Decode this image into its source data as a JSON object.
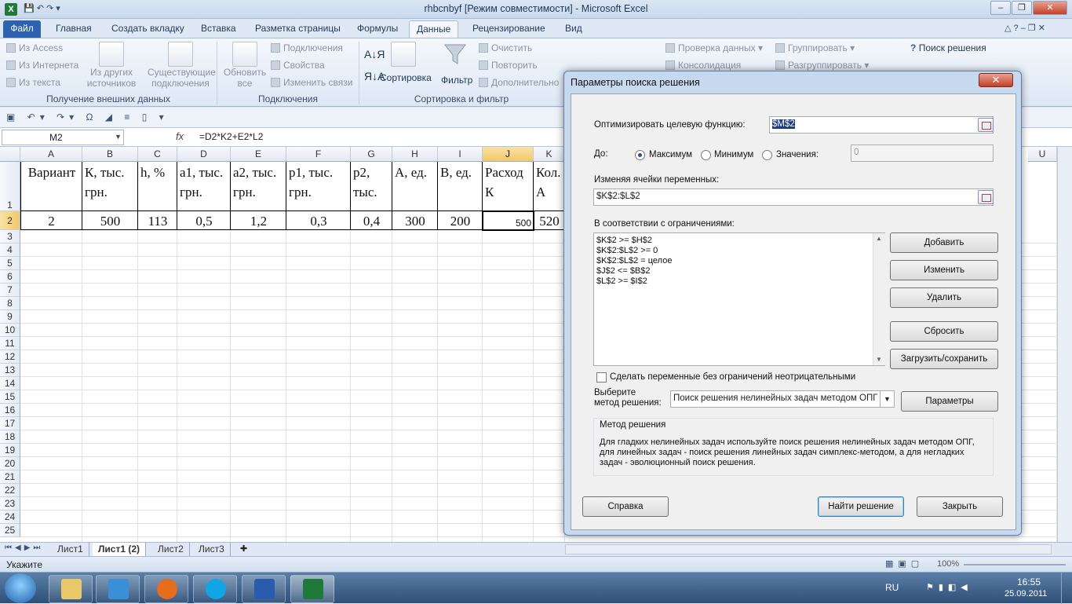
{
  "window": {
    "title": "rhbcnbyf  [Режим совместимости]  -  Microsoft Excel",
    "minimize": "–",
    "restore": "❐",
    "close": "✕"
  },
  "tabs": [
    "Файл",
    "Главная",
    "Создать вкладку",
    "Вставка",
    "Разметка страницы",
    "Формулы",
    "Данные",
    "Рецензирование",
    "Вид"
  ],
  "ribbon": {
    "get_data": {
      "from_access": "Из Access",
      "from_web": "Из Интернета",
      "from_text": "Из текста",
      "other_sources_l1": "Из других",
      "other_sources_l2": "источников",
      "existing_l1": "Существующие",
      "existing_l2": "подключения",
      "label": "Получение внешних данных"
    },
    "connections": {
      "refresh_l1": "Обновить",
      "refresh_l2": "все",
      "connections": "Подключения",
      "properties": "Свойства",
      "edit_links": "Изменить связи",
      "label": "Подключения"
    },
    "sort_filter": {
      "sort": "Сортировка",
      "filter": "Фильтр",
      "clear": "Очистить",
      "reapply": "Повторить",
      "advanced": "Дополнительно",
      "label": "Сортировка и фильтр"
    },
    "data_tools": {
      "validation": "Проверка данных",
      "consolidate": "Консолидация"
    },
    "outline": {
      "group": "Группировать",
      "ungroup": "Разгруппировать"
    },
    "analysis": {
      "solver": "Поиск решения"
    }
  },
  "namebox": "M2",
  "fx": "fx",
  "formula": "=D2*K2+E2*L2",
  "columns": [
    "A",
    "B",
    "C",
    "D",
    "E",
    "F",
    "G",
    "H",
    "I",
    "J",
    "K",
    "U"
  ],
  "rows": [
    "1",
    "2",
    "3",
    "4",
    "5",
    "6",
    "7",
    "8",
    "9",
    "10",
    "11",
    "12",
    "13",
    "14",
    "15",
    "16",
    "17",
    "18",
    "19",
    "20",
    "21",
    "22",
    "23",
    "24",
    "25"
  ],
  "header_cells": {
    "A": "Вариант",
    "B": "К,  тыс. грн.",
    "C": "h, %",
    "D": "а1, тыс. грн.",
    "E": "а2,  тыс. грн.",
    "F": "р1,    тыс. грн.",
    "G": "р2, тыс. грн.",
    "H": "А, ед.",
    "I": "В, ед.",
    "J": "Расход К",
    "K": "Кол. А"
  },
  "row2": {
    "A": "2",
    "B": "500",
    "C": "113",
    "D": "0,5",
    "E": "1,2",
    "F": "0,3",
    "G": "0,4",
    "H": "300",
    "I": "200",
    "J": "500",
    "K": "520"
  },
  "sheets": [
    "Лист1",
    "Лист1 (2)",
    "Лист2",
    "Лист3"
  ],
  "status": {
    "mode": "Укажите",
    "zoom": "100%"
  },
  "taskbar": {
    "lang": "RU",
    "time": "16:55",
    "date": "25.09.2011"
  },
  "dialog": {
    "title": "Параметры поиска решения",
    "objective_label": "Оптимизировать целевую функцию:",
    "objective_value": "$M$2",
    "to_label": "До:",
    "opt_max": "Максимум",
    "opt_min": "Минимум",
    "opt_value": "Значения:",
    "value_field": "0",
    "changing_label": "Изменяя ячейки переменных:",
    "changing_value": "$K$2:$L$2",
    "constraints_label": "В соответствии с ограничениями:",
    "constraints": [
      "$K$2 >= $H$2",
      "$K$2:$L$2 >= 0",
      "$K$2:$L$2 = целое",
      "$J$2 <= $B$2",
      "$L$2 >= $I$2"
    ],
    "btn_add": "Добавить",
    "btn_change": "Изменить",
    "btn_delete": "Удалить",
    "btn_reset": "Сбросить",
    "btn_load": "Загрузить/сохранить",
    "nonneg_label": "Сделать переменные без ограничений неотрицательными",
    "method_label_l1": "Выберите",
    "method_label_l2": "метод решения:",
    "method_value": "Поиск решения нелинейных задач методом ОПГ",
    "btn_options": "Параметры",
    "method_box_title": "Метод решения",
    "method_desc_l1": "Для гладких нелинейных задач используйте поиск решения нелинейных задач методом ОПГ,",
    "method_desc_l2": "для линейных задач - поиск решения линейных задач симплекс-методом, а для негладких",
    "method_desc_l3": "задач - эволюционный поиск решения.",
    "btn_help": "Справка",
    "btn_solve": "Найти решение",
    "btn_close": "Закрыть"
  }
}
